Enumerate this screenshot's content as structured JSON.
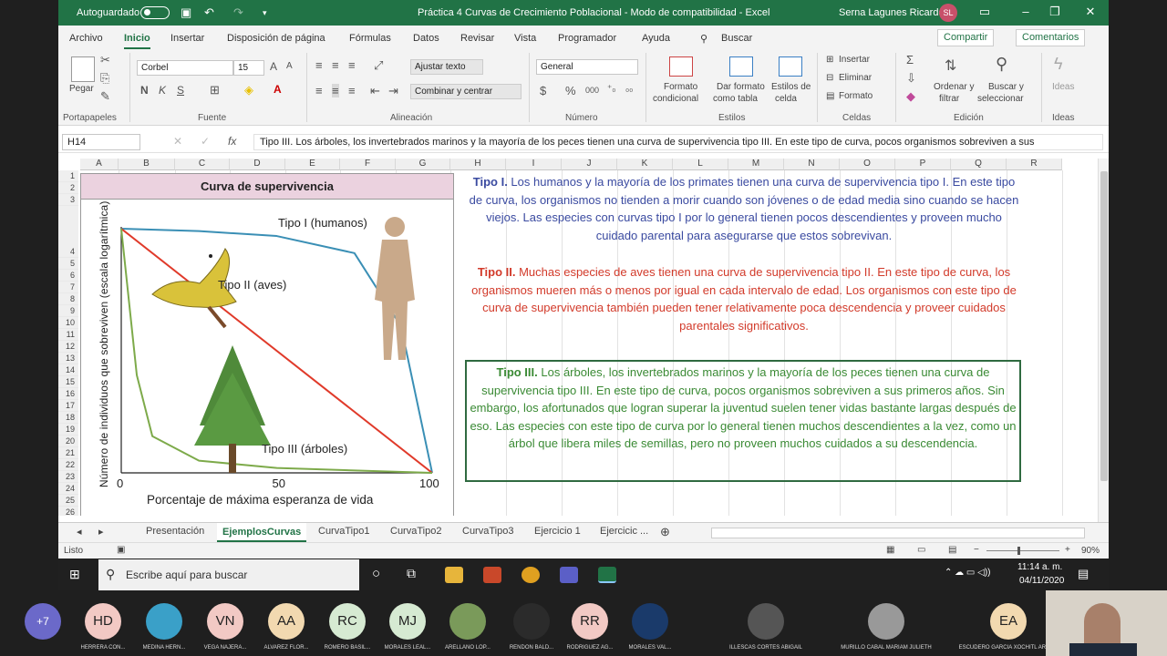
{
  "titlebar": {
    "autosave": "Autoguardado",
    "title": "Práctica 4 Curvas de Crecimiento Poblacional  -  Modo de compatibilidad  -  Excel",
    "user": "Serna Lagunes Ricardo",
    "initials": "SL"
  },
  "tabs": [
    "Archivo",
    "Inicio",
    "Insertar",
    "Disposición de página",
    "Fórmulas",
    "Datos",
    "Revisar",
    "Vista",
    "Programador",
    "Ayuda",
    "Buscar"
  ],
  "share": "Compartir",
  "comments": "Comentarios",
  "ribbon": {
    "paste": "Pegar",
    "font": "Corbel",
    "size": "15",
    "wrap": "Ajustar texto",
    "merge": "Combinar y centrar",
    "numfmt": "General",
    "condfmt1": "Formato",
    "condfmt2": "condicional",
    "tablefmt1": "Dar formato",
    "tablefmt2": "como tabla",
    "cellstyle1": "Estilos de",
    "cellstyle2": "celda",
    "insert": "Insertar",
    "delete": "Eliminar",
    "format": "Formato",
    "sort1": "Ordenar y",
    "sort2": "filtrar",
    "find1": "Buscar y",
    "find2": "seleccionar",
    "ideas": "Ideas",
    "groups": [
      "Portapapeles",
      "Fuente",
      "Alineación",
      "Número",
      "Estilos",
      "Celdas",
      "Edición",
      "Ideas"
    ]
  },
  "namebox": "H14",
  "formula": "Tipo III. Los árboles, los invertebrados marinos y la mayoría de los peces tienen una curva de supervivencia tipo III. En este tipo de curva, pocos organismos sobreviven a sus",
  "columns": [
    "A",
    "B",
    "C",
    "D",
    "E",
    "F",
    "G",
    "H",
    "I",
    "J",
    "K",
    "L",
    "M",
    "N",
    "O",
    "P",
    "Q",
    "R"
  ],
  "rows": [
    "1",
    "2",
    "3",
    "4",
    "5",
    "6",
    "7",
    "8",
    "9",
    "10",
    "11",
    "12",
    "13",
    "14",
    "15",
    "16",
    "17",
    "18",
    "19",
    "20",
    "21",
    "22",
    "23",
    "24",
    "25",
    "26"
  ],
  "chart": {
    "title": "Curva de supervivencia",
    "ylabel": "Número de individuos que sobreviven (escala logarítmica)",
    "xlabel": "Porcentaje de máxima esperanza de vida",
    "xticks": [
      "0",
      "50",
      "100"
    ],
    "label1": "Tipo I (humanos)",
    "label2": "Tipo II (aves)",
    "label3": "Tipo III (árboles)",
    "colors": {
      "type1": "#3a8fb5",
      "type2": "#e03a2a",
      "type3": "#7daa4a"
    }
  },
  "chart_data": {
    "type": "line",
    "title": "Curva de supervivencia",
    "xlabel": "Porcentaje de máxima esperanza de vida",
    "ylabel": "Número de individuos que sobreviven (escala logarítmica)",
    "xlim": [
      0,
      100
    ],
    "series": [
      {
        "name": "Tipo I (humanos)",
        "x": [
          0,
          25,
          50,
          75,
          90,
          95,
          100
        ],
        "y": [
          1,
          0.99,
          0.97,
          0.9,
          0.6,
          0.3,
          0
        ]
      },
      {
        "name": "Tipo II (aves)",
        "x": [
          0,
          100
        ],
        "y": [
          1,
          0
        ]
      },
      {
        "name": "Tipo III (árboles)",
        "x": [
          0,
          5,
          10,
          25,
          50,
          100
        ],
        "y": [
          1,
          0.4,
          0.15,
          0.05,
          0.02,
          0
        ]
      }
    ]
  },
  "text1": {
    "head": "Tipo I.",
    "body": " Los humanos y la mayoría de los primates tienen una curva de supervivencia tipo I. En este tipo de curva, los organismos no tienden a morir cuando son jóvenes o de edad media sino cuando se hacen viejos. Las especies con curvas tipo I por lo general tienen pocos descendientes y proveen mucho cuidado parental para asegurarse que estos sobrevivan."
  },
  "text2": {
    "head": "Tipo II.",
    "body": " Muchas especies de aves tienen una curva de supervivencia tipo II. En este tipo de curva, los organismos mueren más o menos por igual en cada intervalo de edad. Los organismos con este tipo de curva de supervivencia también pueden tener relativamente poca descendencia y proveer cuidados parentales significativos."
  },
  "text3": {
    "head": "Tipo III.",
    "body": " Los árboles, los invertebrados marinos y la mayoría de los peces tienen una curva de supervivencia tipo III. En este tipo de curva, pocos organismos sobreviven a sus primeros años. Sin embargo, los afortunados que logran superar la juventud suelen tener vidas bastante largas después de eso. Las especies con este tipo de curva por lo general tienen muchos descendientes a la vez, como un árbol que libera miles de semillas, pero no proveen muchos cuidados a su descendencia."
  },
  "sheets": [
    "Presentación",
    "EjemplosCurvas",
    "CurvaTipo1",
    "CurvaTipo2",
    "CurvaTipo3",
    "Ejercicio 1",
    "Ejercicic ..."
  ],
  "status": {
    "ready": "Listo",
    "zoom": "90%"
  },
  "taskbar": {
    "search": "Escribe aquí para buscar",
    "time": "11:14 a. m.",
    "date": "04/11/2020"
  },
  "participants": [
    {
      "ini": "+7",
      "name": "",
      "color": "#6b69c9"
    },
    {
      "ini": "HD",
      "name": "HERRERA CON...",
      "color": "#f2c9c4"
    },
    {
      "ini": "",
      "name": "MEDINA HERN...",
      "color": "#3aa0c8"
    },
    {
      "ini": "VN",
      "name": "VEGA NAJERA...",
      "color": "#f2c9c4"
    },
    {
      "ini": "AA",
      "name": "ALVAREZ FLOR...",
      "color": "#f2d9b0"
    },
    {
      "ini": "RC",
      "name": "ROMERO BASIL...",
      "color": "#d6ead2"
    },
    {
      "ini": "MJ",
      "name": "MORALES LEAL...",
      "color": "#d6ead2"
    },
    {
      "ini": "",
      "name": "ARELLANO LOP...",
      "color": "#7a9a5a"
    },
    {
      "ini": "",
      "name": "RENDON BALD...",
      "color": "#2b2b2b"
    },
    {
      "ini": "RR",
      "name": "RODRIGUEZ AG...",
      "color": "#f2c9c4"
    },
    {
      "ini": "",
      "name": "MORALES VAL...",
      "color": "#1a3a6a"
    },
    {
      "ini": "",
      "name": "ILLESCAS CORTES ABIGAIL",
      "color": "#555"
    },
    {
      "ini": "",
      "name": "MURILLO CABAL MARIAM JULIETH",
      "color": "#999"
    },
    {
      "ini": "EA",
      "name": "ESCUDERO GARCIA XOCHITL ARAC...",
      "color": "#f2d9b0"
    }
  ]
}
